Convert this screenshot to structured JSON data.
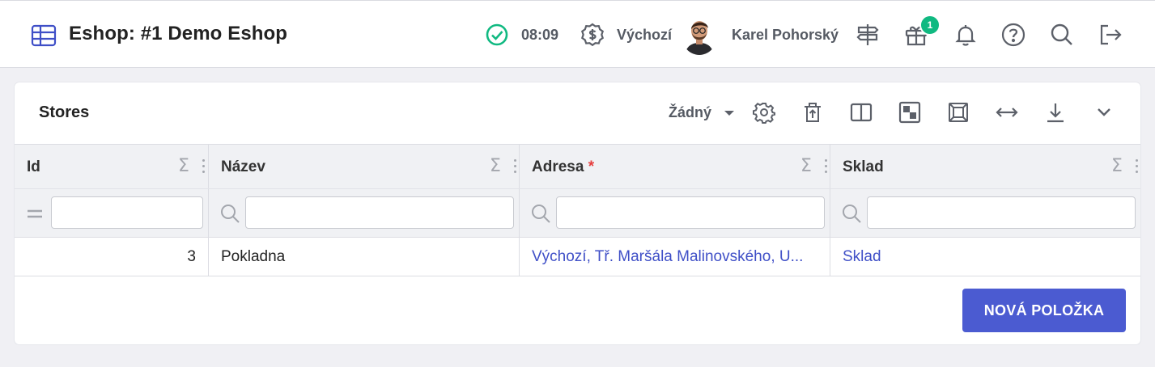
{
  "header": {
    "app_title": "Eshop: #1 Demo Eshop",
    "clock": "08:09",
    "currency_label": "Výchozí",
    "user_name": "Karel Pohorský",
    "notification_badge": "1",
    "icons": [
      "table-icon",
      "status-check-icon",
      "currency-icon",
      "signpost-icon",
      "gift-icon",
      "bell-icon",
      "help-icon",
      "search-icon",
      "logout-icon"
    ]
  },
  "card": {
    "title": "Stores",
    "toolbar": {
      "select_value": "Žádný",
      "icons": [
        "gear-icon",
        "trash-restore-icon",
        "split-view-icon",
        "grid-icon",
        "fit-screen-icon",
        "expand-horizontal-icon",
        "download-icon",
        "chevron-down-icon"
      ]
    },
    "columns": [
      {
        "label": "Id",
        "required": false,
        "sigma": "Σ"
      },
      {
        "label": "Název",
        "required": false,
        "sigma": "Σ"
      },
      {
        "label": "Adresa",
        "required": true,
        "required_mark": "*",
        "sigma": "Σ"
      },
      {
        "label": "Sklad",
        "required": false,
        "sigma": "Σ"
      }
    ],
    "filters": [
      {
        "operator": "=",
        "value": ""
      },
      {
        "operator": "search",
        "value": ""
      },
      {
        "operator": "search",
        "value": ""
      },
      {
        "operator": "search",
        "value": ""
      }
    ],
    "rows": [
      {
        "id": "3",
        "name": "Pokladna",
        "address": "Výchozí, Tř. Maršála Malinovského, U...",
        "store": "Sklad"
      }
    ],
    "new_button_label": "NOVÁ POLOŽKA"
  },
  "colors": {
    "accent": "#4b5bd1",
    "link": "#3f4fc7",
    "success": "#10b981",
    "required": "#e53e3e"
  }
}
